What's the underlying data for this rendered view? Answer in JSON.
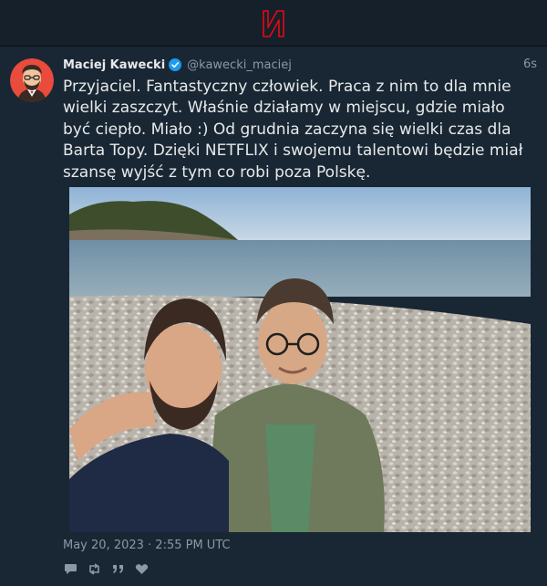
{
  "app": {
    "logo_icon": "netflix-n-logo",
    "accent_color": "#e50914"
  },
  "tweet": {
    "author_name": "Maciej Kawecki",
    "author_handle": "@kawecki_maciej",
    "verified_icon": "verified-badge-icon",
    "verified_color": "#1d9bf0",
    "relative_time": "6s",
    "text": "Przyjaciel. Fantastyczny człowiek. Praca z nim to dla mnie wielki zaszczyt. Właśnie działamy w miejscu, gdzie miało być ciepło. Miało :) Od grudnia zaczyna się wielki czas dla Barta Topy. Dzięki NETFLIX i swojemu talentowi będzie miał szansę wyjść z tym co robi poza Polskę.",
    "timestamp": "May 20, 2023 · 2:55 PM UTC",
    "actions": [
      {
        "icon": "reply-icon"
      },
      {
        "icon": "retweet-icon"
      },
      {
        "icon": "quote-icon"
      },
      {
        "icon": "like-icon"
      }
    ]
  }
}
